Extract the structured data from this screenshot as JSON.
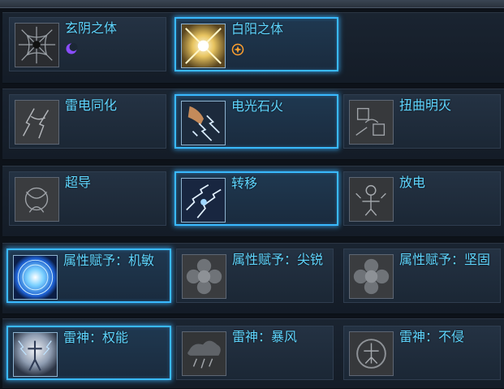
{
  "talents": [
    {
      "row": 1,
      "nodes": [
        {
          "name": "玄阴之体",
          "icon": "dark-web-icon",
          "selected": false,
          "badge": "moon-icon"
        },
        {
          "name": "白阳之体",
          "icon": "radiant-burst-icon",
          "selected": true,
          "badge": "sun-icon"
        }
      ]
    },
    {
      "row": 2,
      "nodes": [
        {
          "name": "雷电同化",
          "icon": "lightning-assimilation-icon",
          "selected": false
        },
        {
          "name": "电光石火",
          "icon": "lightning-strike-icon",
          "selected": true
        },
        {
          "name": "扭曲明灭",
          "icon": "distortion-icon",
          "selected": false
        }
      ]
    },
    {
      "row": 3,
      "nodes": [
        {
          "name": "超导",
          "icon": "superconduct-icon",
          "selected": false
        },
        {
          "name": "转移",
          "icon": "transfer-icon",
          "selected": true
        },
        {
          "name": "放电",
          "icon": "discharge-icon",
          "selected": false
        }
      ]
    },
    {
      "row": 4,
      "nodes": [
        {
          "name": "属性赋予：机敏",
          "icon": "blue-orb-icon",
          "selected": true
        },
        {
          "name": "属性赋予：尖锐",
          "icon": "grey-flower-icon",
          "selected": false
        },
        {
          "name": "属性赋予：坚固",
          "icon": "grey-flower-icon",
          "selected": false
        }
      ]
    },
    {
      "row": 5,
      "nodes": [
        {
          "name": "雷神：权能",
          "icon": "thunder-god-power-icon",
          "selected": true
        },
        {
          "name": "雷神：暴风",
          "icon": "storm-icon",
          "selected": false
        },
        {
          "name": "雷神：不侵",
          "icon": "guardian-icon",
          "selected": false
        }
      ]
    }
  ],
  "colors": {
    "label": "#5fd6ff",
    "selected_border": "#39b9ff",
    "card_bg": "#1b2735",
    "moon_badge": "#8a4dff",
    "sun_badge": "#ffa02e"
  }
}
